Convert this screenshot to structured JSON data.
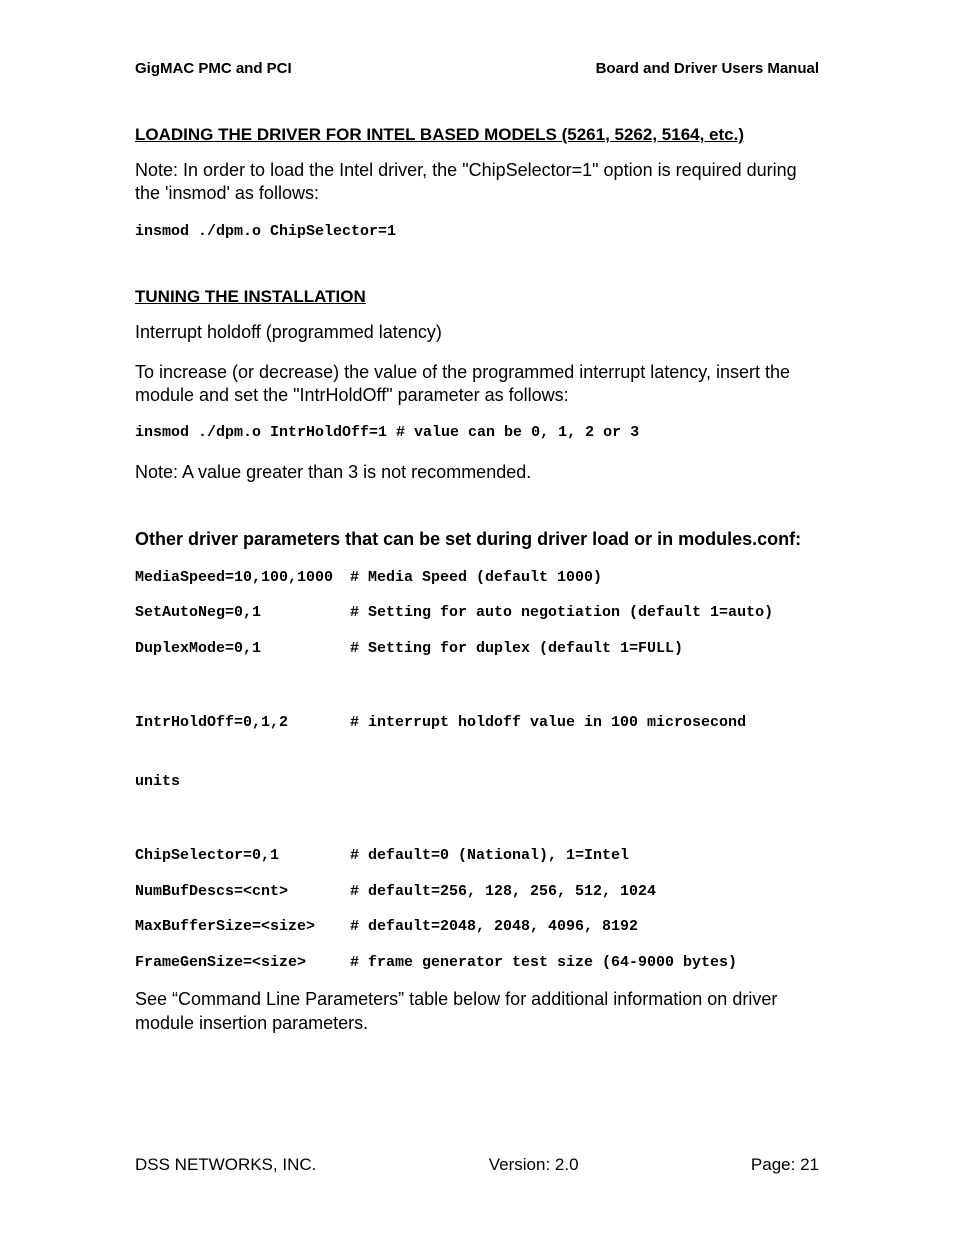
{
  "header": {
    "left": "GigMAC PMC and PCI",
    "right": "Board and Driver Users Manual"
  },
  "section1": {
    "heading": "LOADING THE DRIVER FOR INTEL BASED MODELS (5261, 5262, 5164, etc.)",
    "note": "Note: In order to load the Intel driver, the \"ChipSelector=1\" option is required during the 'insmod' as follows:",
    "code": "insmod ./dpm.o ChipSelector=1"
  },
  "section2": {
    "heading": "TUNING THE INSTALLATION",
    "line1": "Interrupt holdoff (programmed latency)",
    "line2": "To increase (or decrease) the value of the programmed interrupt latency, insert the module and set the \"IntrHoldOff\" parameter as follows:",
    "code": "insmod ./dpm.o IntrHoldOff=1 # value can be 0, 1, 2 or 3",
    "note": "Note: A value greater than 3 is not recommended."
  },
  "section3": {
    "heading": "Other driver parameters that can be set during driver load or in modules.conf:",
    "params": [
      {
        "name": "MediaSpeed=10,100,1000",
        "desc": "# Media Speed (default 1000)"
      },
      {
        "name": "SetAutoNeg=0,1",
        "desc": "# Setting for auto negotiation (default 1=auto)"
      },
      {
        "name": "DuplexMode=0,1",
        "desc": "# Setting for duplex (default 1=FULL)"
      }
    ],
    "intrhold": {
      "line1_name": "IntrHoldOff=0,1,2",
      "line1_desc": "# interrupt holdoff value in 100 microsecond",
      "line2": "units"
    },
    "params2": [
      {
        "name": "ChipSelector=0,1",
        "desc": "# default=0 (National), 1=Intel"
      },
      {
        "name": "NumBufDescs=<cnt>",
        "desc": "# default=256, 128, 256, 512, 1024"
      },
      {
        "name": "MaxBufferSize=<size>",
        "desc": "# default=2048, 2048, 4096, 8192"
      },
      {
        "name": "FrameGenSize=<size>",
        "desc": "# frame generator test size (64-9000 bytes)"
      }
    ],
    "closing": "See “Command Line Parameters” table below for additional information on driver module insertion parameters."
  },
  "footer": {
    "left": "DSS NETWORKS, INC.",
    "center": "Version: 2.0",
    "right": "Page: 21"
  }
}
